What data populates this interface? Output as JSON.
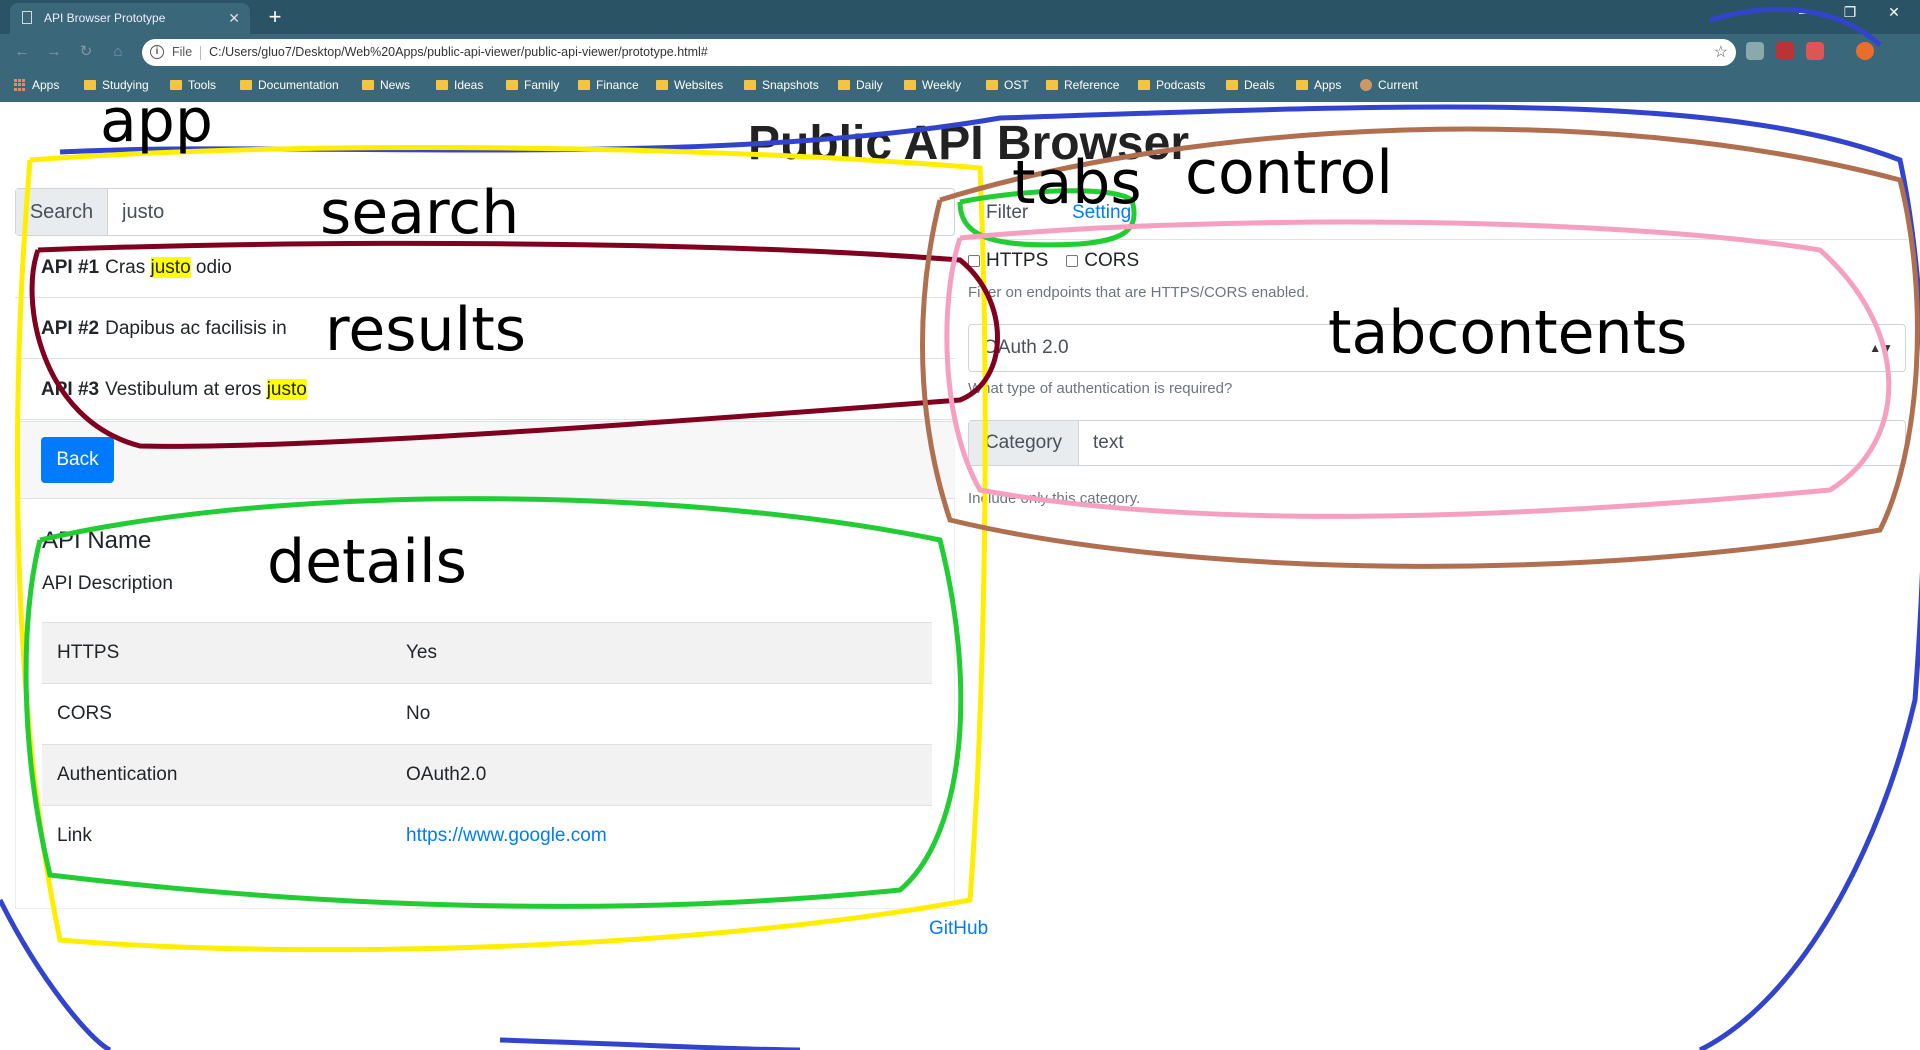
{
  "browser": {
    "tab_title": "API Browser Prototype",
    "tab_close": "✕",
    "new_tab": "+",
    "window_controls": [
      "—",
      "❐",
      "✕"
    ],
    "url_scheme": "File",
    "url": "C:/Users/gluo7/Desktop/Web%20Apps/public-api-viewer/public-api-viewer/prototype.html#",
    "bookmarks": [
      "Apps",
      "Studying",
      "Tools",
      "Documentation",
      "News",
      "Ideas",
      "Family",
      "Finance",
      "Websites",
      "Snapshots",
      "Daily",
      "Weekly",
      "OST",
      "Reference",
      "Podcasts",
      "Deals",
      "Apps",
      "Current"
    ]
  },
  "page": {
    "title": "Public API Browser",
    "search": {
      "label": "Search",
      "value": "justo"
    },
    "results": [
      {
        "id": "API #1",
        "pre": "Cras ",
        "hl": "justo",
        "post": " odio"
      },
      {
        "id": "API #2",
        "pre": "Dapibus ac facilisis in",
        "hl": "",
        "post": ""
      },
      {
        "id": "API #3",
        "pre": "Vestibulum at eros ",
        "hl": "justo",
        "post": ""
      }
    ],
    "back_label": "Back",
    "details": {
      "name": "API Name",
      "description": "API Description",
      "rows": [
        {
          "key": "HTTPS",
          "value": "Yes"
        },
        {
          "key": "CORS",
          "value": "No"
        },
        {
          "key": "Authentication",
          "value": "OAuth2.0"
        },
        {
          "key": "Link",
          "value": "https://www.google.com"
        }
      ]
    },
    "github": "GitHub",
    "control": {
      "tabs": [
        "Filter",
        "Setting"
      ],
      "active_tab": "Setting",
      "checkboxes": [
        "HTTPS",
        "CORS"
      ],
      "checkbox_help": "Filter on endpoints that are HTTPS/CORS enabled.",
      "auth_select": "OAuth 2.0",
      "auth_help": "What type of authentication is required?",
      "category_label": "Category",
      "category_value": "text",
      "category_help": "Include only this category."
    }
  },
  "annotations": {
    "app": "app",
    "search": "search",
    "results": "results",
    "details": "details",
    "tabs": "tabs",
    "control": "control",
    "tabcontents": "tabcontents"
  },
  "colors": {
    "primary": "#007bff",
    "highlight": "#ffff00",
    "ink_app": "#3344cc",
    "ink_search": "#ffee00",
    "ink_results": "#800020",
    "ink_details": "#22cc33",
    "ink_tabs": "#22cc33",
    "ink_control": "#b07050",
    "ink_tabcontents": "#f5a0c0"
  }
}
